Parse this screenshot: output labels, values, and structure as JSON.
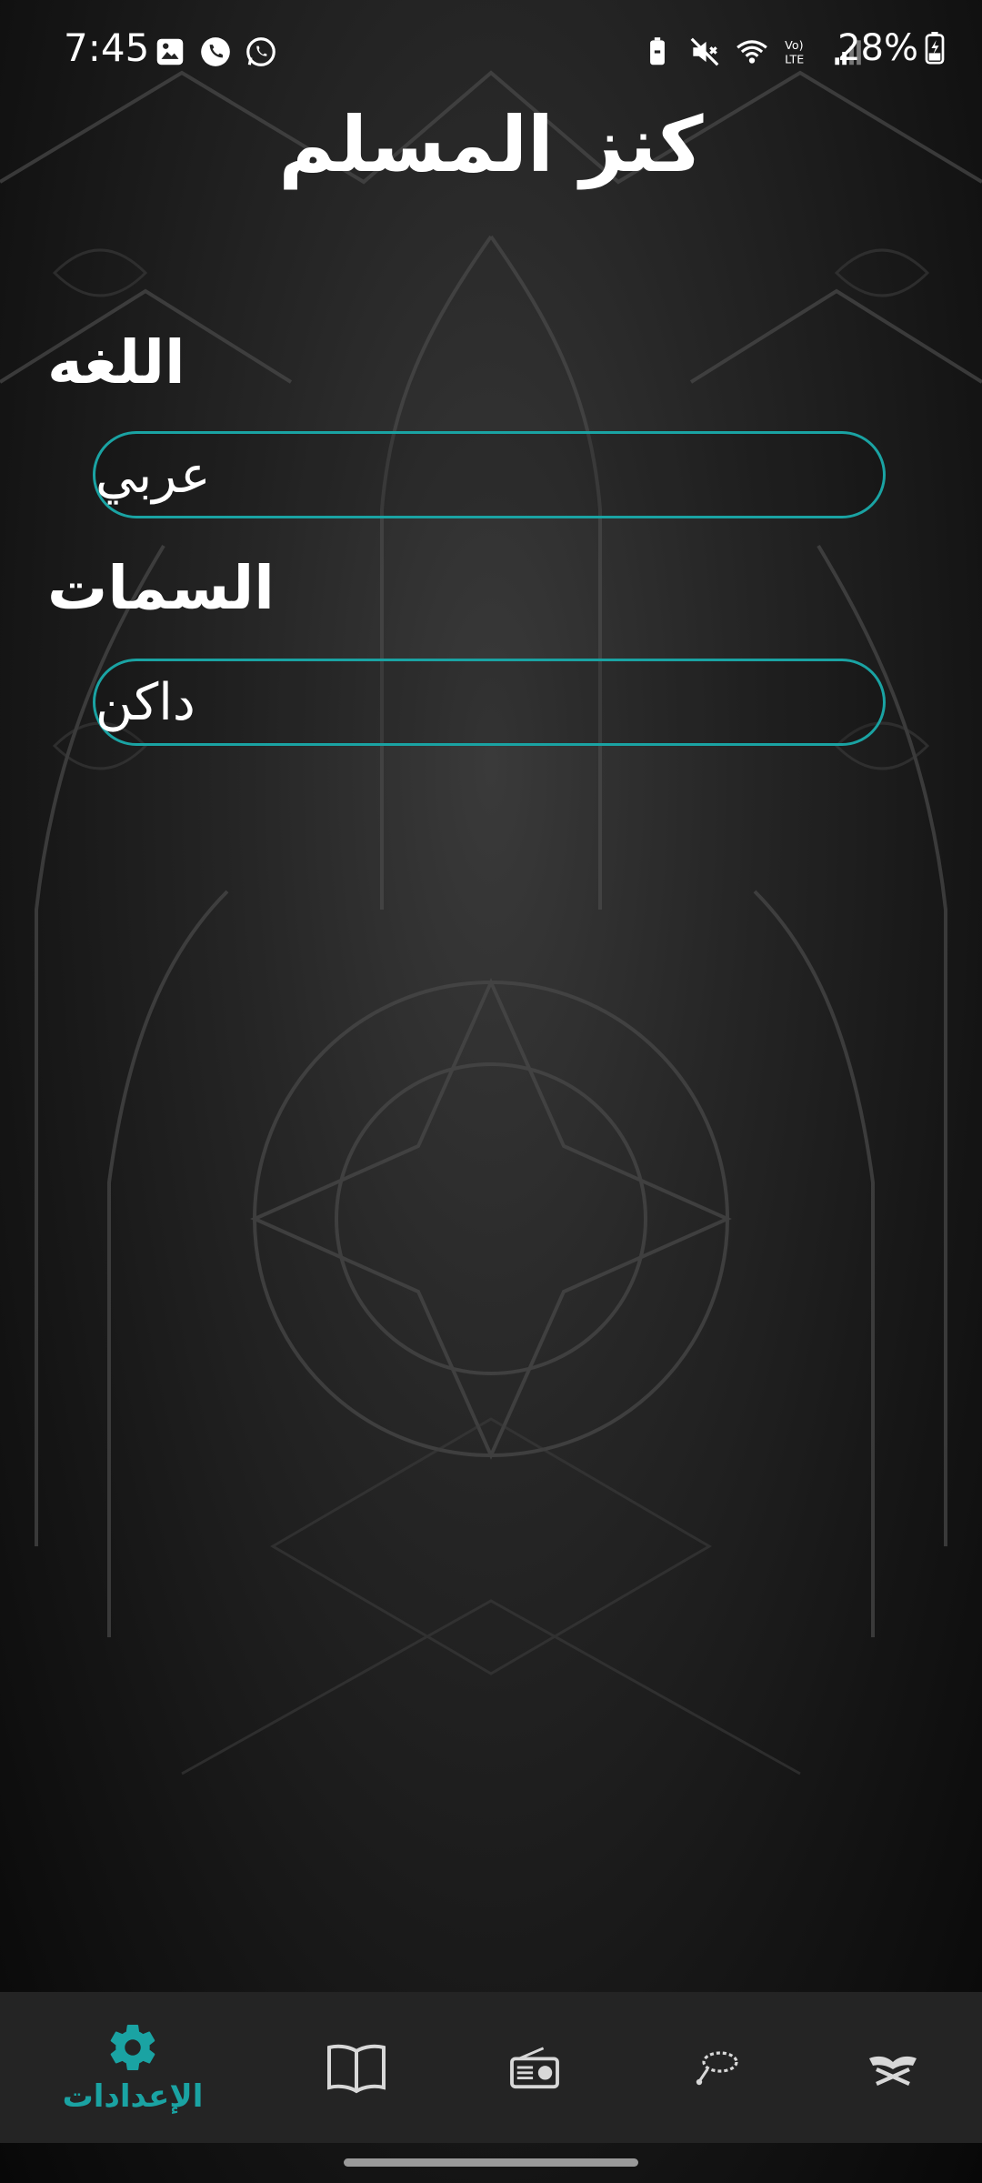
{
  "status_bar": {
    "time": "7:45",
    "battery": "28%"
  },
  "app": {
    "title": "كنز المسلم"
  },
  "settings": {
    "language_label": "اللغه",
    "language_value": "عربي",
    "theme_label": "السمات",
    "theme_value": "داكن"
  },
  "bottom_nav": {
    "settings_label": "الإعدادات",
    "active_color": "#1aa3a3",
    "inactive_color": "#d8d8d8",
    "items": [
      {
        "icon": "gear-icon",
        "active": true
      },
      {
        "icon": "open-book-icon",
        "active": false
      },
      {
        "icon": "radio-icon",
        "active": false
      },
      {
        "icon": "prayer-beads-icon",
        "active": false
      },
      {
        "icon": "quran-stand-icon",
        "active": false
      }
    ]
  },
  "colors": {
    "accent": "#1aa3a3",
    "background": "#262626",
    "nav_background": "#242424"
  }
}
